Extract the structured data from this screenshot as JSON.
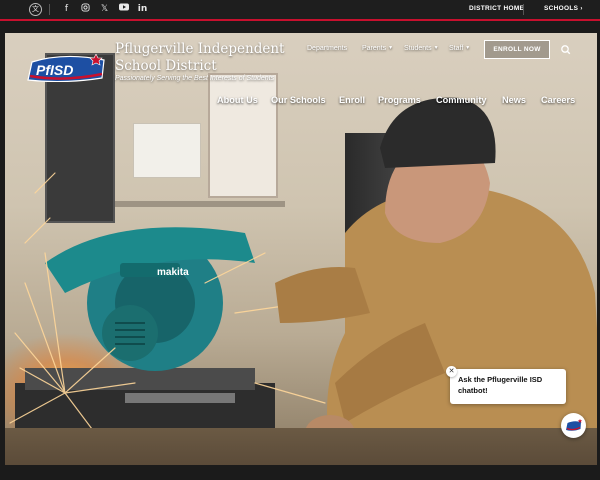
{
  "topbar": {
    "social_icons": [
      "translate-icon",
      "facebook-icon",
      "instagram-icon",
      "x-icon",
      "youtube-icon",
      "linkedin-icon"
    ],
    "district_home": "DISTRICT HOME",
    "schools": "SCHOOLS"
  },
  "brand": {
    "logo_text": "PfISD",
    "title_line1": "Pflugerville Independent",
    "title_line2": "School District",
    "tagline": "Passionately Serving the Best Interests of Students"
  },
  "subnav": {
    "departments": "Departments",
    "parents": "Parents",
    "students": "Students",
    "staff": "Staff",
    "enroll": "ENROLL NOW"
  },
  "mainnav": [
    "About Us",
    "Our Schools",
    "Enroll",
    "Programs",
    "Community",
    "News",
    "Careers"
  ],
  "hero": {
    "saw_brand": "makita"
  },
  "chatbot": {
    "message": "Ask the Pflugerville ISD chatbot!"
  },
  "colors": {
    "accent_red": "#c8102e",
    "logo_blue": "#1d4fa3",
    "topbar_bg": "#1e1e1e"
  }
}
